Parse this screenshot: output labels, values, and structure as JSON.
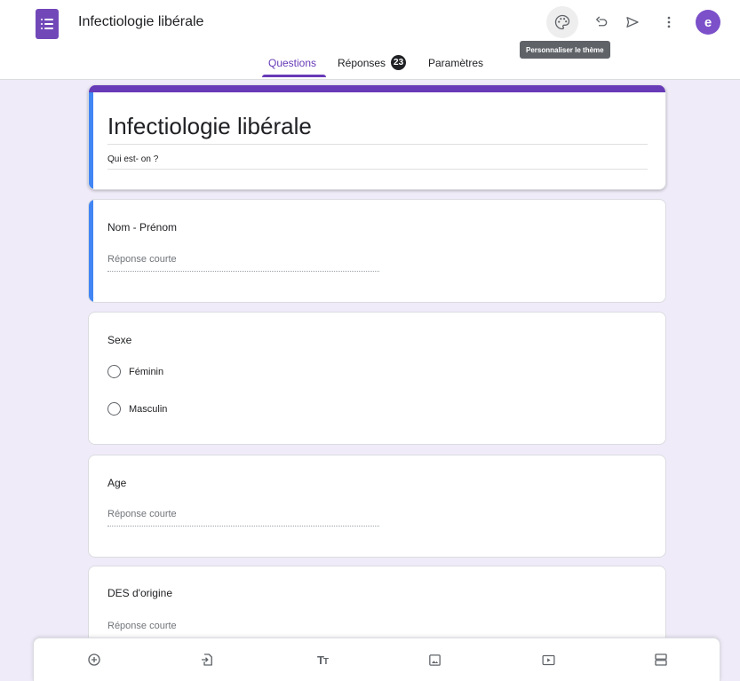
{
  "header": {
    "title": "Infectiologie libérale",
    "avatar_letter": "e",
    "tooltip": "Personnaliser le thème",
    "icons": [
      "palette-icon",
      "undo-icon",
      "send-icon",
      "more-vert-icon"
    ]
  },
  "tabs": {
    "questions": "Questions",
    "responses": "Réponses",
    "responses_count": "23",
    "settings": "Paramètres"
  },
  "form": {
    "title": "Infectiologie libérale",
    "description": "Qui est- on ?",
    "questions": [
      {
        "title": "Nom - Prénom",
        "type": "short",
        "placeholder": "Réponse courte"
      },
      {
        "title": "Sexe",
        "type": "radio",
        "options": [
          "Féminin",
          "Masculin"
        ]
      },
      {
        "title": "Age",
        "type": "short",
        "placeholder": "Réponse courte"
      },
      {
        "title": "DES d'origine",
        "type": "short",
        "placeholder": "Réponse courte"
      }
    ]
  },
  "toolbar": {
    "icons": [
      "add-question-icon",
      "import-questions-icon",
      "add-title-icon",
      "add-image-icon",
      "add-video-icon",
      "add-section-icon"
    ],
    "title_glyph_big": "T",
    "title_glyph_small": "T"
  },
  "colors": {
    "accent": "#673ab7",
    "background": "#f0ebf8",
    "selected": "#4285f4",
    "logo": "#7248b9"
  }
}
